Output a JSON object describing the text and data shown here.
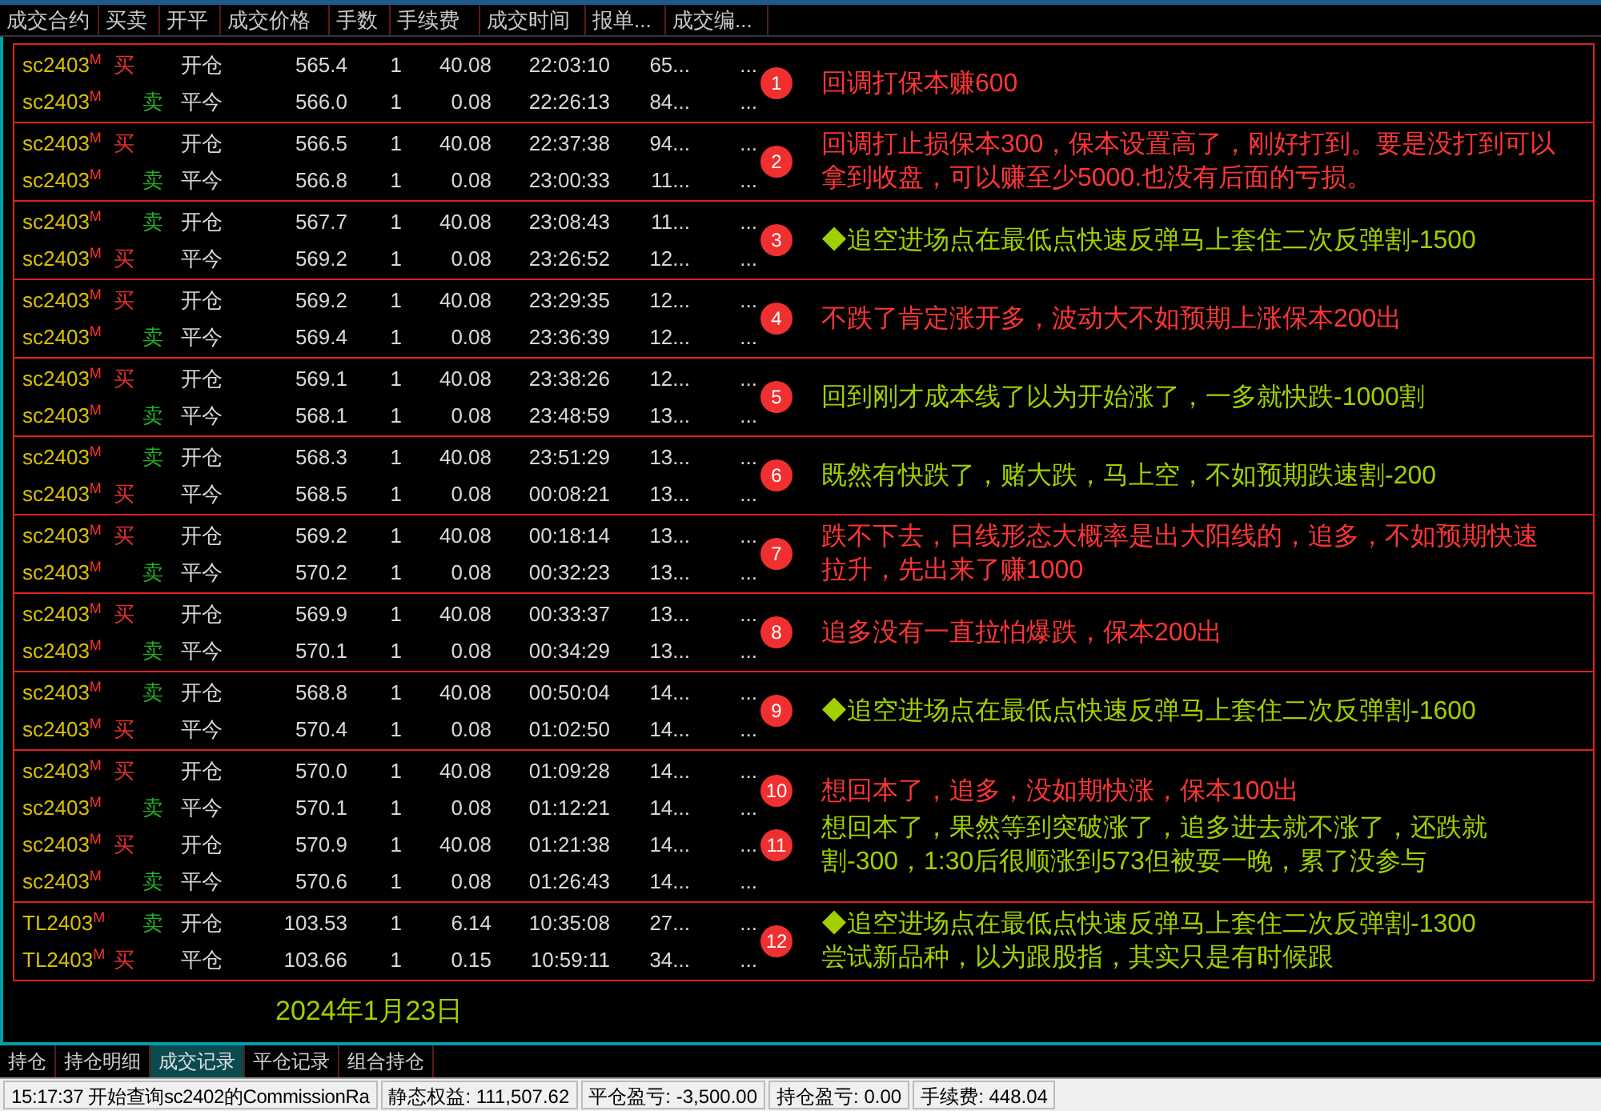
{
  "columns": [
    {
      "label": "成交合约"
    },
    {
      "label": "买卖"
    },
    {
      "label": "开平"
    },
    {
      "label": "成交价格"
    },
    {
      "label": "手数"
    },
    {
      "label": "手续费"
    },
    {
      "label": "成交时间"
    },
    {
      "label": "报单..."
    },
    {
      "label": "成交编..."
    }
  ],
  "groups": [
    {
      "trades": [
        {
          "contract": "sc2403",
          "mark": "M",
          "side": "买",
          "kind": "buy",
          "offset": "开仓",
          "price": "565.4",
          "qty": "1",
          "fee": "40.08",
          "time": "22:03:10",
          "order": "65...",
          "trade_no": "..."
        },
        {
          "contract": "sc2403",
          "mark": "M",
          "side": "卖",
          "kind": "sell",
          "offset": "平今",
          "price": "566.0",
          "qty": "1",
          "fee": "0.08",
          "time": "22:26:13",
          "order": "84...",
          "trade_no": "..."
        }
      ],
      "annotations": [
        {
          "badge": "1",
          "lines": [
            {
              "text": "回调打保本赚600",
              "color": "#ff3535"
            }
          ]
        }
      ]
    },
    {
      "trades": [
        {
          "contract": "sc2403",
          "mark": "M",
          "side": "买",
          "kind": "buy",
          "offset": "开仓",
          "price": "566.5",
          "qty": "1",
          "fee": "40.08",
          "time": "22:37:38",
          "order": "94...",
          "trade_no": "..."
        },
        {
          "contract": "sc2403",
          "mark": "M",
          "side": "卖",
          "kind": "sell",
          "offset": "平今",
          "price": "566.8",
          "qty": "1",
          "fee": "0.08",
          "time": "23:00:33",
          "order": "11...",
          "trade_no": "..."
        }
      ],
      "annotations": [
        {
          "badge": "2",
          "lines": [
            {
              "text": "回调打止损保本300，保本设置高了，刚好打到。要是没打到可以拿到收盘，可以赚至少5000.也没有后面的亏损。",
              "color": "#ff3535"
            }
          ]
        }
      ]
    },
    {
      "trades": [
        {
          "contract": "sc2403",
          "mark": "M",
          "side": "卖",
          "kind": "sell",
          "offset": "开仓",
          "price": "567.7",
          "qty": "1",
          "fee": "40.08",
          "time": "23:08:43",
          "order": "11...",
          "trade_no": "..."
        },
        {
          "contract": "sc2403",
          "mark": "M",
          "side": "买",
          "kind": "buy",
          "offset": "平今",
          "price": "569.2",
          "qty": "1",
          "fee": "0.08",
          "time": "23:26:52",
          "order": "12...",
          "trade_no": "..."
        }
      ],
      "annotations": [
        {
          "badge": "3",
          "lines": [
            {
              "text": "◆追空进场点在最低点快速反弹马上套住二次反弹割-1500",
              "color": "#a0d000"
            }
          ]
        }
      ]
    },
    {
      "trades": [
        {
          "contract": "sc2403",
          "mark": "M",
          "side": "买",
          "kind": "buy",
          "offset": "开仓",
          "price": "569.2",
          "qty": "1",
          "fee": "40.08",
          "time": "23:29:35",
          "order": "12...",
          "trade_no": "..."
        },
        {
          "contract": "sc2403",
          "mark": "M",
          "side": "卖",
          "kind": "sell",
          "offset": "平今",
          "price": "569.4",
          "qty": "1",
          "fee": "0.08",
          "time": "23:36:39",
          "order": "12...",
          "trade_no": "..."
        }
      ],
      "annotations": [
        {
          "badge": "4",
          "lines": [
            {
              "text": "不跌了肯定涨开多，波动大不如预期上涨保本200出",
              "color": "#ff3535"
            }
          ]
        }
      ]
    },
    {
      "trades": [
        {
          "contract": "sc2403",
          "mark": "M",
          "side": "买",
          "kind": "buy",
          "offset": "开仓",
          "price": "569.1",
          "qty": "1",
          "fee": "40.08",
          "time": "23:38:26",
          "order": "12...",
          "trade_no": "..."
        },
        {
          "contract": "sc2403",
          "mark": "M",
          "side": "卖",
          "kind": "sell",
          "offset": "平今",
          "price": "568.1",
          "qty": "1",
          "fee": "0.08",
          "time": "23:48:59",
          "order": "13...",
          "trade_no": "..."
        }
      ],
      "annotations": [
        {
          "badge": "5",
          "lines": [
            {
              "text": "回到刚才成本线了以为开始涨了，一多就快跌-1000割",
              "color": "#a0d000"
            }
          ]
        }
      ]
    },
    {
      "trades": [
        {
          "contract": "sc2403",
          "mark": "M",
          "side": "卖",
          "kind": "sell",
          "offset": "开仓",
          "price": "568.3",
          "qty": "1",
          "fee": "40.08",
          "time": "23:51:29",
          "order": "13...",
          "trade_no": "..."
        },
        {
          "contract": "sc2403",
          "mark": "M",
          "side": "买",
          "kind": "buy",
          "offset": "平今",
          "price": "568.5",
          "qty": "1",
          "fee": "0.08",
          "time": "00:08:21",
          "order": "13...",
          "trade_no": "..."
        }
      ],
      "annotations": [
        {
          "badge": "6",
          "lines": [
            {
              "text": "既然有快跌了，赌大跌，马上空，不如预期跌速割-200",
              "color": "#a0d000"
            }
          ]
        }
      ]
    },
    {
      "trades": [
        {
          "contract": "sc2403",
          "mark": "M",
          "side": "买",
          "kind": "buy",
          "offset": "开仓",
          "price": "569.2",
          "qty": "1",
          "fee": "40.08",
          "time": "00:18:14",
          "order": "13...",
          "trade_no": "..."
        },
        {
          "contract": "sc2403",
          "mark": "M",
          "side": "卖",
          "kind": "sell",
          "offset": "平今",
          "price": "570.2",
          "qty": "1",
          "fee": "0.08",
          "time": "00:32:23",
          "order": "13...",
          "trade_no": "..."
        }
      ],
      "annotations": [
        {
          "badge": "7",
          "lines": [
            {
              "text": "跌不下去，日线形态大概率是出大阳线的，追多，不如预期快速拉升，先出来了赚1000",
              "color": "#ff3535"
            }
          ]
        }
      ]
    },
    {
      "trades": [
        {
          "contract": "sc2403",
          "mark": "M",
          "side": "买",
          "kind": "buy",
          "offset": "开仓",
          "price": "569.9",
          "qty": "1",
          "fee": "40.08",
          "time": "00:33:37",
          "order": "13...",
          "trade_no": "..."
        },
        {
          "contract": "sc2403",
          "mark": "M",
          "side": "卖",
          "kind": "sell",
          "offset": "平今",
          "price": "570.1",
          "qty": "1",
          "fee": "0.08",
          "time": "00:34:29",
          "order": "13...",
          "trade_no": "..."
        }
      ],
      "annotations": [
        {
          "badge": "8",
          "lines": [
            {
              "text": "追多没有一直拉怕爆跌，保本200出",
              "color": "#ff3535"
            }
          ]
        }
      ]
    },
    {
      "trades": [
        {
          "contract": "sc2403",
          "mark": "M",
          "side": "卖",
          "kind": "sell",
          "offset": "开仓",
          "price": "568.8",
          "qty": "1",
          "fee": "40.08",
          "time": "00:50:04",
          "order": "14...",
          "trade_no": "..."
        },
        {
          "contract": "sc2403",
          "mark": "M",
          "side": "买",
          "kind": "buy",
          "offset": "平今",
          "price": "570.4",
          "qty": "1",
          "fee": "0.08",
          "time": "01:02:50",
          "order": "14...",
          "trade_no": "..."
        }
      ],
      "annotations": [
        {
          "badge": "9",
          "lines": [
            {
              "text": "◆追空进场点在最低点快速反弹马上套住二次反弹割-1600",
              "color": "#a0d000"
            }
          ]
        }
      ]
    },
    {
      "trades": [
        {
          "contract": "sc2403",
          "mark": "M",
          "side": "买",
          "kind": "buy",
          "offset": "开仓",
          "price": "570.0",
          "qty": "1",
          "fee": "40.08",
          "time": "01:09:28",
          "order": "14...",
          "trade_no": "..."
        },
        {
          "contract": "sc2403",
          "mark": "M",
          "side": "卖",
          "kind": "sell",
          "offset": "平今",
          "price": "570.1",
          "qty": "1",
          "fee": "0.08",
          "time": "01:12:21",
          "order": "14...",
          "trade_no": "..."
        },
        {
          "contract": "sc2403",
          "mark": "M",
          "side": "买",
          "kind": "buy",
          "offset": "开仓",
          "price": "570.9",
          "qty": "1",
          "fee": "40.08",
          "time": "01:21:38",
          "order": "14...",
          "trade_no": "..."
        },
        {
          "contract": "sc2403",
          "mark": "M",
          "side": "卖",
          "kind": "sell",
          "offset": "平今",
          "price": "570.6",
          "qty": "1",
          "fee": "0.08",
          "time": "01:26:43",
          "order": "14...",
          "trade_no": "..."
        }
      ],
      "annotations": [
        {
          "badge": "10",
          "lines": [
            {
              "text": "想回本了，追多，没如期快涨，保本100出",
              "color": "#ff3535"
            }
          ]
        },
        {
          "badge": "11",
          "lines": [
            {
              "text": "想回本了，果然等到突破涨了，追多进去就不涨了，还跌就割-300，1:30后很顺涨到573但被耍一晚，累了没参与",
              "color": "#a0d000"
            }
          ]
        }
      ]
    },
    {
      "trades": [
        {
          "contract": "TL2403",
          "mark": "M",
          "side": "卖",
          "kind": "sell",
          "offset": "开仓",
          "price": "103.53",
          "qty": "1",
          "fee": "6.14",
          "time": "10:35:08",
          "order": "27...",
          "trade_no": "..."
        },
        {
          "contract": "TL2403",
          "mark": "M",
          "side": "买",
          "kind": "buy",
          "offset": "平仓",
          "price": "103.66",
          "qty": "1",
          "fee": "0.15",
          "time": "10:59:11",
          "order": "34...",
          "trade_no": "..."
        }
      ],
      "annotations": [
        {
          "badge": "12",
          "lines": [
            {
              "text": "◆追空进场点在最低点快速反弹马上套住二次反弹割-1300",
              "color": "#a0d000"
            },
            {
              "text": "尝试新品种，以为跟股指，其实只是有时候跟",
              "color": "#a0d000"
            }
          ]
        }
      ]
    }
  ],
  "date": "2024年1月23日",
  "tabs": [
    {
      "label": "持仓",
      "selected": false
    },
    {
      "label": "持仓明细",
      "selected": false
    },
    {
      "label": "成交记录",
      "selected": true
    },
    {
      "label": "平仓记录",
      "selected": false
    },
    {
      "label": "组合持仓",
      "selected": false
    }
  ],
  "status_bar": [
    "15:17:37 开始查询sc2402的CommissionRa",
    "静态权益: 111,507.62",
    "平仓盈亏: -3,500.00",
    "持仓盈亏: 0.00",
    "手续费: 448.04"
  ]
}
